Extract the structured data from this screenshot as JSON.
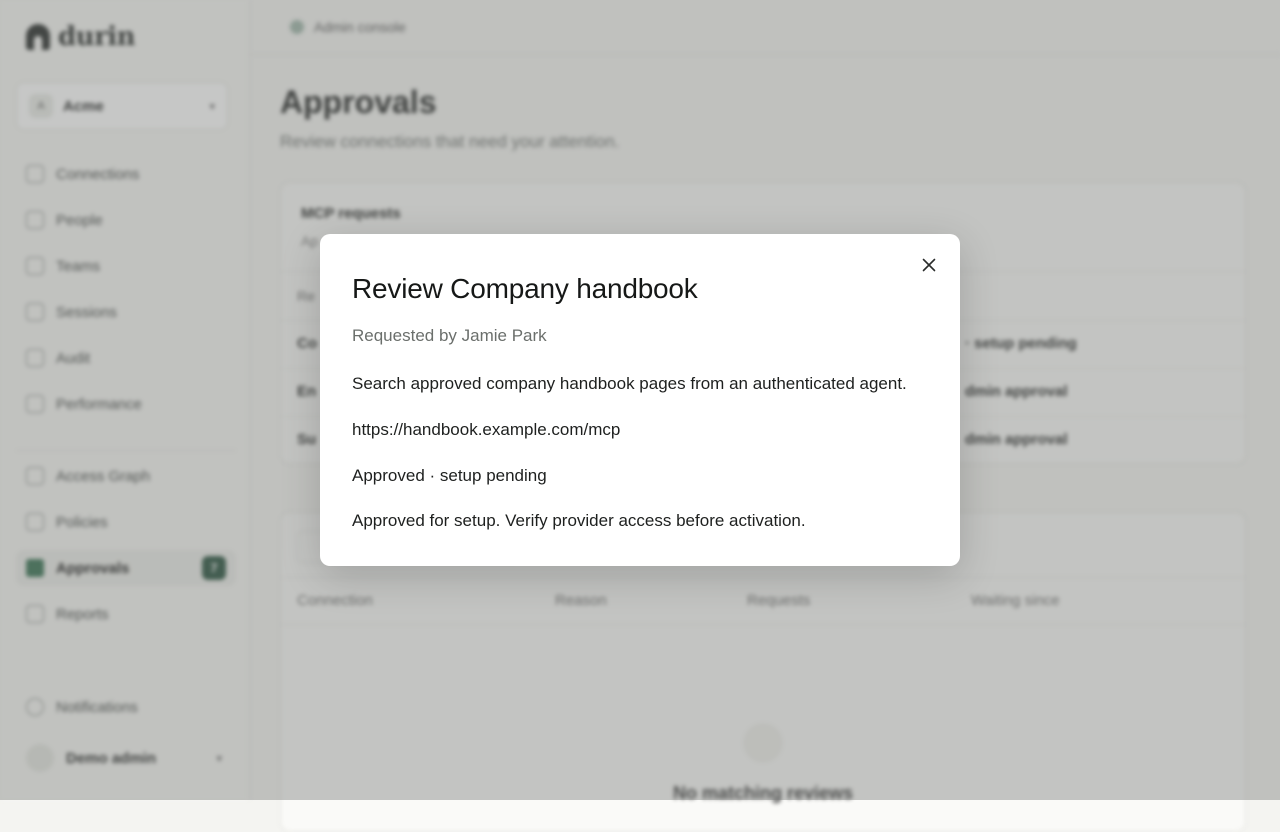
{
  "sidebar": {
    "brand": "durin",
    "org": {
      "avatar": "A",
      "name": "Acme"
    },
    "nav_primary": [
      {
        "label": "Connections",
        "icon": "plug-icon"
      },
      {
        "label": "People",
        "icon": "people-icon"
      },
      {
        "label": "Teams",
        "icon": "team-icon"
      },
      {
        "label": "Sessions",
        "icon": "shield-icon"
      },
      {
        "label": "Audit",
        "icon": "activity-icon"
      },
      {
        "label": "Performance",
        "icon": "gauge-icon"
      }
    ],
    "nav_secondary": [
      {
        "label": "Access Graph",
        "icon": "graph-icon"
      },
      {
        "label": "Policies",
        "icon": "policy-icon"
      },
      {
        "label": "Approvals",
        "icon": "check-icon",
        "badge": "7"
      },
      {
        "label": "Reports",
        "icon": "report-icon"
      }
    ],
    "notifications": "Notifications",
    "user": "Demo admin"
  },
  "topbar": {
    "breadcrumb": "Admin console"
  },
  "page": {
    "title": "Approvals",
    "subtitle": "Review connections that need your attention."
  },
  "mcp_card": {
    "title": "MCP requests",
    "subtitle": "Ap",
    "header_first": "Re",
    "rows": [
      {
        "name": "Co",
        "status": "· setup pending"
      },
      {
        "name": "En",
        "status": "dmin approval"
      },
      {
        "name": "Su",
        "status": "dmin approval"
      }
    ]
  },
  "reviews_card": {
    "columns": [
      "Connection",
      "Reason",
      "Requests",
      "Waiting since"
    ],
    "empty": "No matching reviews"
  },
  "dialog": {
    "title": "Review Company handbook",
    "requested_by": "Requested by Jamie Park",
    "description": "Search approved company handbook pages from an authenticated agent.",
    "url": "https://handbook.example.com/mcp",
    "status": "Approved · setup pending",
    "note": "Approved for setup. Verify provider access before activation."
  }
}
